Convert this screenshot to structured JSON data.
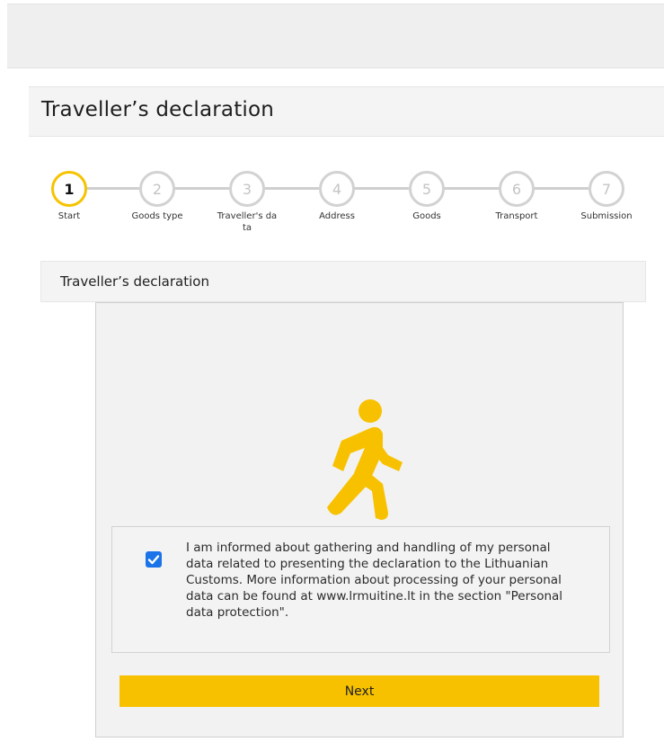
{
  "header": {
    "title": "Traveller’s declaration"
  },
  "stepper": {
    "current_step": 1,
    "steps": [
      {
        "number": "1",
        "label": "Start"
      },
      {
        "number": "2",
        "label": "Goods type"
      },
      {
        "number": "3",
        "label": "Traveller's data"
      },
      {
        "number": "4",
        "label": "Address"
      },
      {
        "number": "5",
        "label": "Goods"
      },
      {
        "number": "6",
        "label": "Transport"
      },
      {
        "number": "7",
        "label": "Submission"
      }
    ]
  },
  "section": {
    "title": "Traveller’s declaration"
  },
  "illustration": {
    "icon": "walking-person-icon"
  },
  "consent": {
    "checked": true,
    "text": "I am informed about gathering and handling of my personal data related to presenting the declaration to the Lithuanian Customs. More information about processing of your personal data can be found at www.lrmuitine.lt in the section \"Personal data protection\"."
  },
  "actions": {
    "next_label": "Next"
  },
  "colors": {
    "accent": "#f8c100",
    "checkbox": "#1a73e8",
    "inactive_step": "#d2d2d2"
  }
}
